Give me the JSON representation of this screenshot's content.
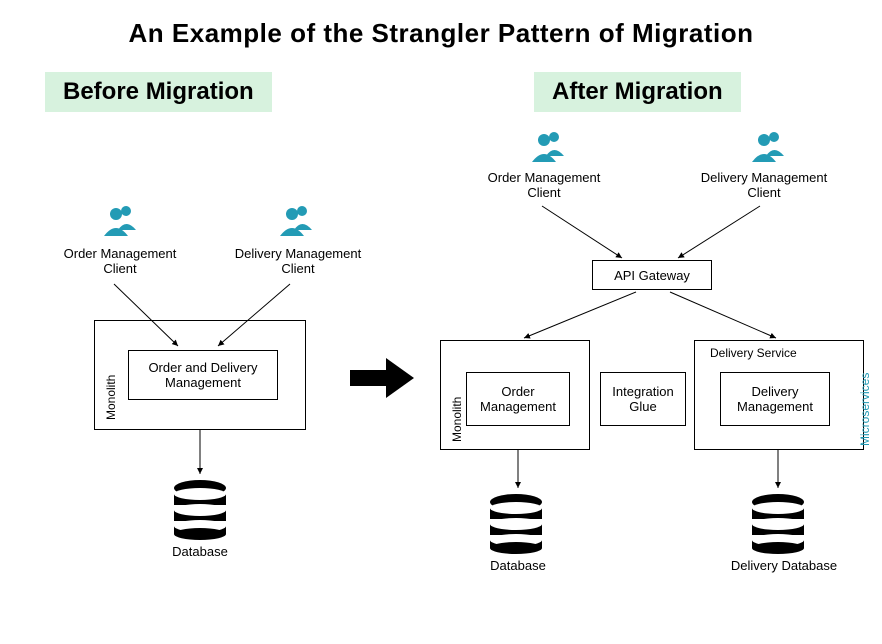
{
  "title": "An Example of the Strangler Pattern of Migration",
  "before": {
    "heading": "Before Migration",
    "clients": {
      "order": "Order Management Client",
      "delivery": "Delivery Management Client"
    },
    "monolith_label": "Monolith",
    "module": "Order and Delivery Management",
    "db": "Database"
  },
  "after": {
    "heading": "After Migration",
    "clients": {
      "order": "Order Management Client",
      "delivery": "Delivery Management Client"
    },
    "api_gateway": "API Gateway",
    "monolith_label": "Monolith",
    "delivery_service_label": "Delivery Service",
    "microservices_label": "Microservices",
    "module_order": "Order Management",
    "module_glue": "Integration Glue",
    "module_delivery": "Delivery Management",
    "db1": "Database",
    "db2": "Delivery Database"
  },
  "colors": {
    "icon_teal": "#239bb5",
    "label_bg": "#d7f2de"
  }
}
